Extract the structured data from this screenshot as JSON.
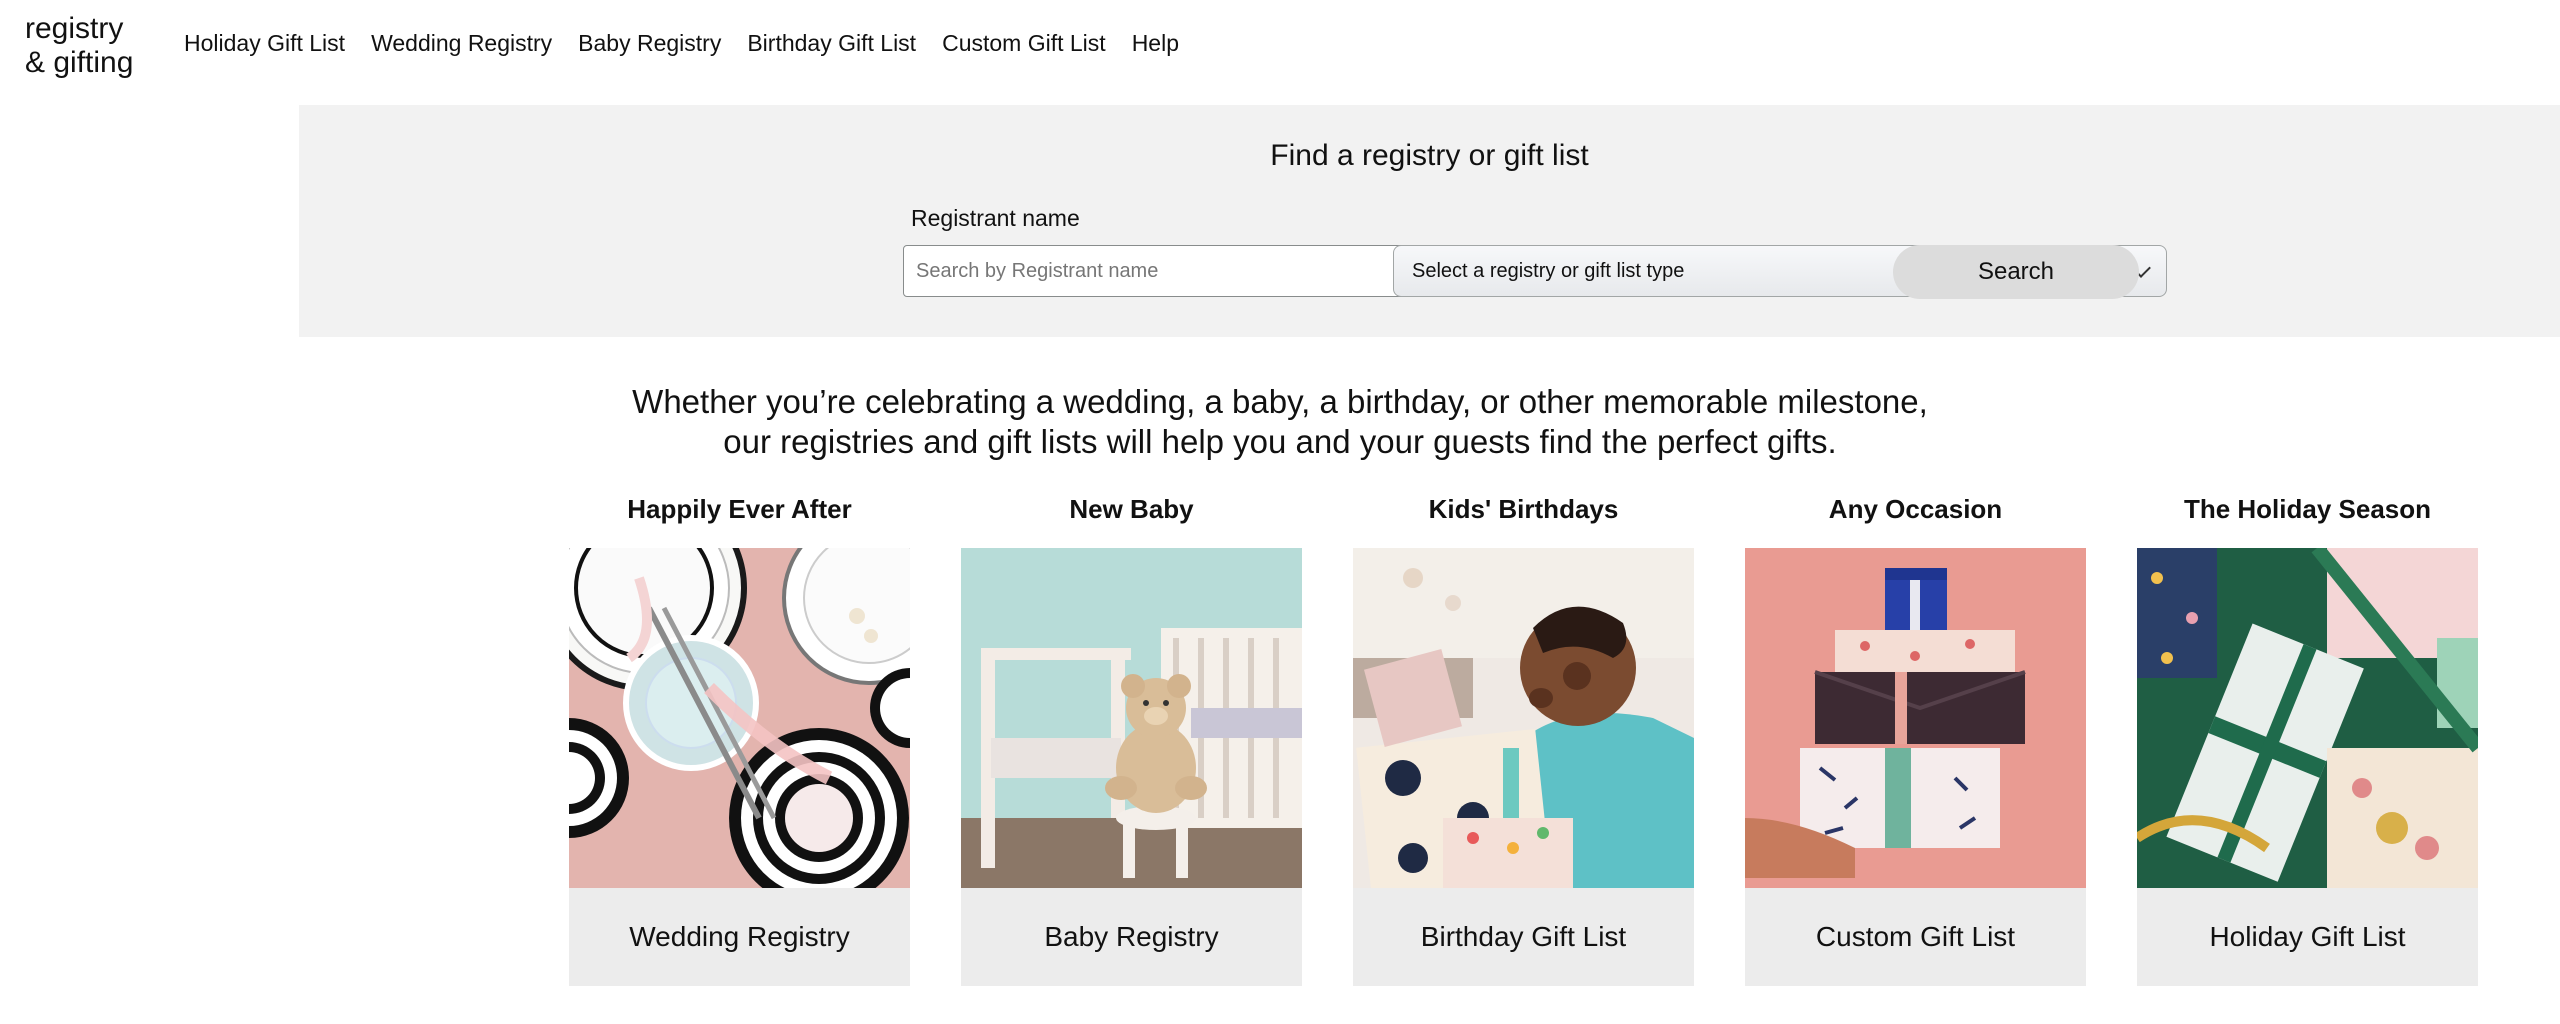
{
  "logo": {
    "line1": "registry",
    "line2": "& gifting"
  },
  "nav": {
    "items": [
      {
        "label": "Holiday Gift List"
      },
      {
        "label": "Wedding Registry"
      },
      {
        "label": "Baby Registry"
      },
      {
        "label": "Birthday Gift List"
      },
      {
        "label": "Custom Gift List"
      },
      {
        "label": "Help"
      }
    ]
  },
  "search": {
    "title": "Find a registry or gift list",
    "name_label": "Registrant name",
    "name_placeholder": "Search by Registrant name",
    "name_value": "",
    "type_selected": "Select a registry or gift list type",
    "button_label": "Search"
  },
  "tagline": {
    "line1": "Whether you’re celebrating a wedding, a baby, a birthday, or other memorable milestone,",
    "line2": "our registries and gift lists will help you and your guests find the perfect gifts."
  },
  "cards": [
    {
      "heading": "Happily Ever After",
      "footer": "Wedding Registry",
      "image": "wedding-tableware-photo"
    },
    {
      "heading": "New Baby",
      "footer": "Baby Registry",
      "image": "teddy-bear-nursery-photo"
    },
    {
      "heading": "Kids' Birthdays",
      "footer": "Birthday Gift List",
      "image": "boy-birthday-gifts-photo"
    },
    {
      "heading": "Any Occasion",
      "footer": "Custom Gift List",
      "image": "stacked-gift-boxes-photo"
    },
    {
      "heading": "The Holiday Season",
      "footer": "Holiday Gift List",
      "image": "wrapped-holiday-gifts-photo"
    }
  ],
  "colors": {
    "search_band_bg": "#f2f2f2",
    "card_footer_bg": "#ececec",
    "search_button_bg": "#dcdcdc"
  }
}
